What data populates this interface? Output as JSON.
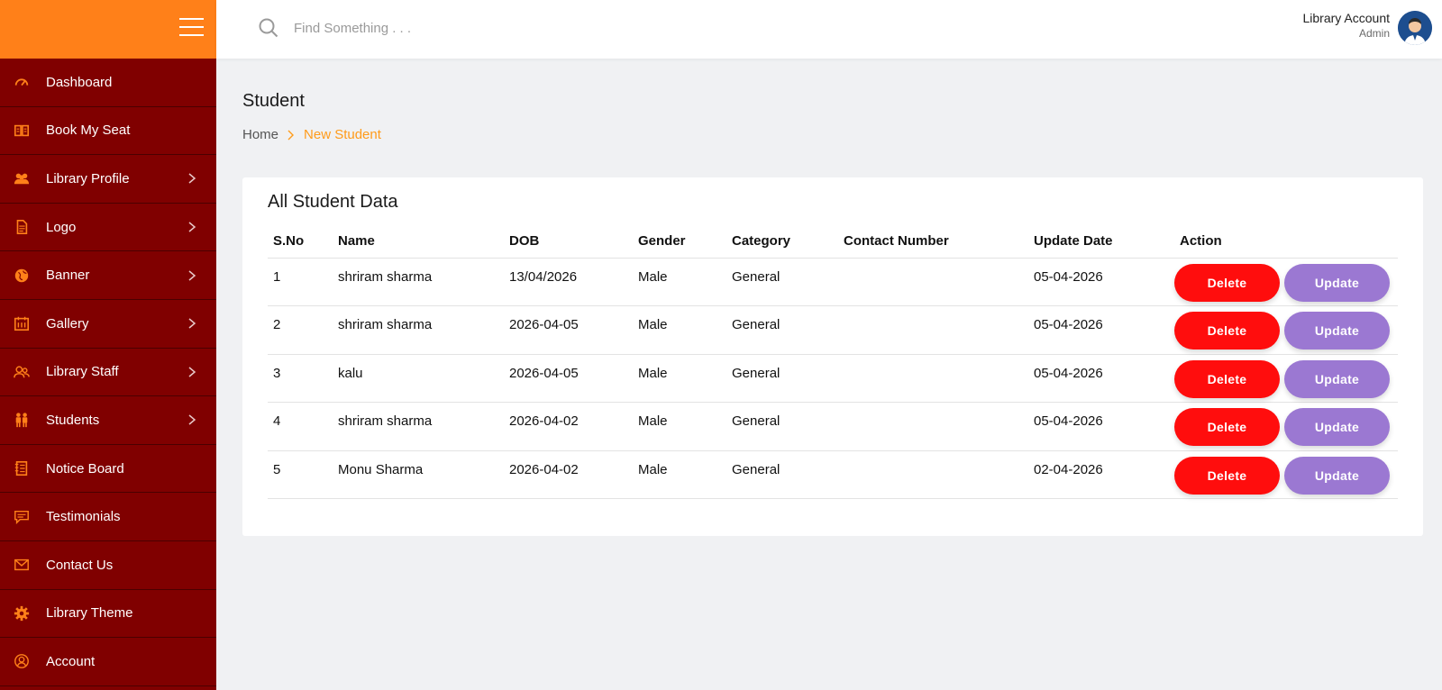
{
  "sidebar": {
    "items": [
      {
        "label": "Dashboard",
        "icon": "gauge-icon",
        "has_submenu": false
      },
      {
        "label": "Book My Seat",
        "icon": "book-icon",
        "has_submenu": false
      },
      {
        "label": "Library Profile",
        "icon": "users-icon",
        "has_submenu": true
      },
      {
        "label": "Logo",
        "icon": "file-icon",
        "has_submenu": true
      },
      {
        "label": "Banner",
        "icon": "globe-icon",
        "has_submenu": true
      },
      {
        "label": "Gallery",
        "icon": "calendar-icon",
        "has_submenu": true
      },
      {
        "label": "Library Staff",
        "icon": "staff-icon",
        "has_submenu": true
      },
      {
        "label": "Students",
        "icon": "students-icon",
        "has_submenu": true
      },
      {
        "label": "Notice Board",
        "icon": "notebook-icon",
        "has_submenu": false
      },
      {
        "label": "Testimonials",
        "icon": "chat-icon",
        "has_submenu": false
      },
      {
        "label": "Contact Us",
        "icon": "mail-icon",
        "has_submenu": false
      },
      {
        "label": "Library Theme",
        "icon": "gear-icon",
        "has_submenu": false
      },
      {
        "label": "Account",
        "icon": "account-icon",
        "has_submenu": false
      }
    ]
  },
  "topbar": {
    "search_placeholder": "Find Something . . .",
    "account_name": "Library Account",
    "account_role": "Admin"
  },
  "page": {
    "title": "Student",
    "breadcrumb": {
      "home": "Home",
      "current": "New Student"
    }
  },
  "card": {
    "title": "All Student Data",
    "columns": [
      "S.No",
      "Name",
      "DOB",
      "Gender",
      "Category",
      "Contact Number",
      "Update Date",
      "Action"
    ],
    "rows": [
      {
        "sno": "1",
        "name": "shriram sharma",
        "dob": "13/04/2026",
        "gender": "Male",
        "category": "General",
        "contact": "",
        "update_date": "05-04-2026"
      },
      {
        "sno": "2",
        "name": "shriram sharma",
        "dob": "2026-04-05",
        "gender": "Male",
        "category": "General",
        "contact": "",
        "update_date": "05-04-2026"
      },
      {
        "sno": "3",
        "name": "kalu",
        "dob": "2026-04-05",
        "gender": "Male",
        "category": "General",
        "contact": "",
        "update_date": "05-04-2026"
      },
      {
        "sno": "4",
        "name": "shriram sharma",
        "dob": "2026-04-02",
        "gender": "Male",
        "category": "General",
        "contact": "",
        "update_date": "05-04-2026"
      },
      {
        "sno": "5",
        "name": "Monu Sharma",
        "dob": "2026-04-02",
        "gender": "Male",
        "category": "General",
        "contact": "",
        "update_date": "02-04-2026"
      }
    ],
    "delete_label": "Delete",
    "update_label": "Update"
  },
  "colors": {
    "sidebar_bg": "#800000",
    "sidebar_header": "#ff8019",
    "accent_orange": "#ff9b1a",
    "delete_red": "#ff0d0d",
    "update_purple": "#9b78d2"
  }
}
